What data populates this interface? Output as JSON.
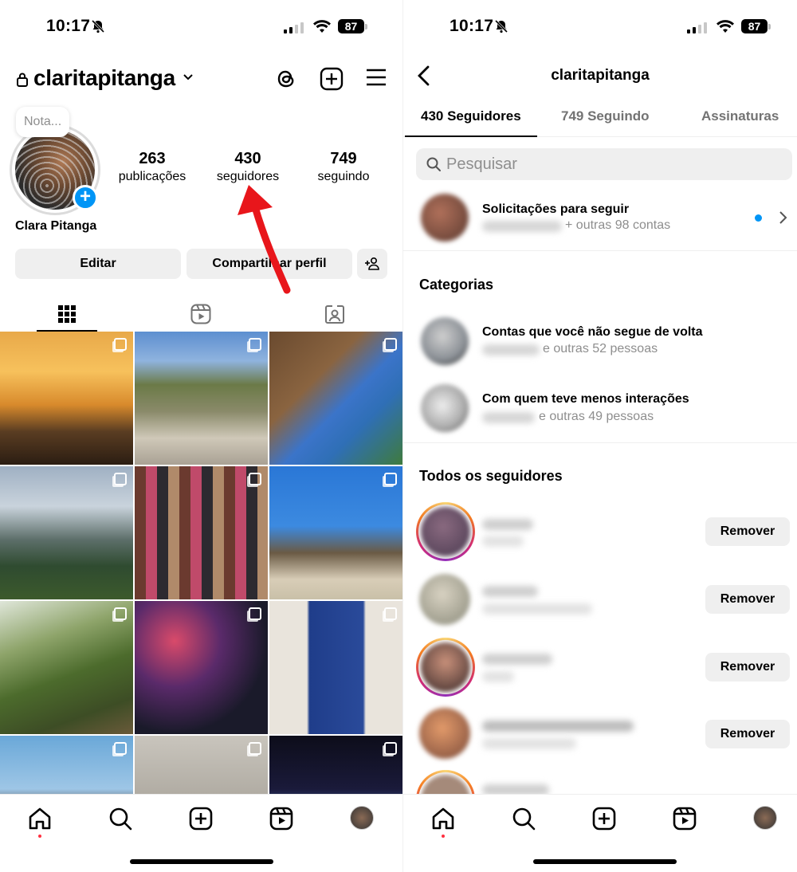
{
  "status_bar": {
    "time": "10:17",
    "battery": "87"
  },
  "profile": {
    "username": "claritapitanga",
    "note_placeholder": "Nota...",
    "full_name": "Clara Pitanga",
    "stats": [
      {
        "value": "263",
        "label": "publicações"
      },
      {
        "value": "430",
        "label": "seguidores"
      },
      {
        "value": "749",
        "label": "seguindo"
      }
    ],
    "edit_button": "Editar",
    "share_button": "Compartilhar perfil",
    "add_badge": "+"
  },
  "followers_screen": {
    "title": "claritapitanga",
    "tabs": [
      "430 Seguidores",
      "749 Seguindo",
      "Assinaturas"
    ],
    "search_placeholder": "Pesquisar",
    "requests_title": "Solicitações para seguir",
    "requests_sub": "+ outras 98 contas",
    "categories_heading": "Categorias",
    "categories": [
      {
        "title": "Contas que você não segue de volta",
        "sub": "e outras 52 pessoas"
      },
      {
        "title": "Com quem teve menos interações",
        "sub": "e outras 49 pessoas"
      }
    ],
    "all_followers_heading": "Todos os seguidores",
    "remove_label": "Remover"
  },
  "colors": {
    "accent": "#0095f6",
    "button_bg": "#efefef",
    "notification_dot": "#ff3040",
    "annotation_arrow": "#e8161b"
  },
  "icons": [
    "lock-icon",
    "chevron-down-icon",
    "threads-icon",
    "new-post-icon",
    "menu-icon",
    "grid-icon",
    "reels-icon",
    "tagged-icon",
    "home-icon",
    "search-icon",
    "create-icon",
    "reels-nav-icon",
    "profile-avatar",
    "back-icon",
    "chevron-right-icon",
    "add-person-icon"
  ]
}
